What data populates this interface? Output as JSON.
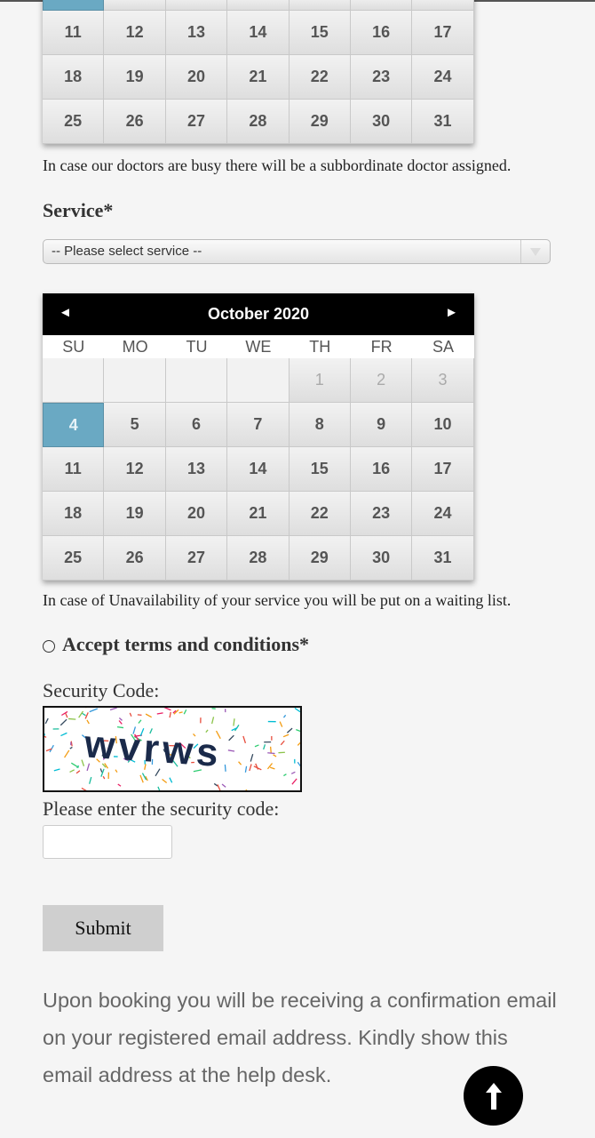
{
  "calendar_top": {
    "rows": [
      [
        "11",
        "12",
        "13",
        "14",
        "15",
        "16",
        "17"
      ],
      [
        "18",
        "19",
        "20",
        "21",
        "22",
        "23",
        "24"
      ],
      [
        "25",
        "26",
        "27",
        "28",
        "29",
        "30",
        "31"
      ]
    ]
  },
  "doctor_note": "In case our doctors are busy there will be a subbordinate doctor assigned.",
  "service": {
    "label": "Service*",
    "placeholder": "-- Please select service --"
  },
  "calendar": {
    "month_title": "October 2020",
    "prev_icon": "◄",
    "next_icon": "►",
    "weekdays": [
      "SU",
      "MO",
      "TU",
      "WE",
      "TH",
      "FR",
      "SA"
    ],
    "selected_day": "4",
    "rows": [
      [
        "",
        "",
        "",
        "",
        "1",
        "2",
        "3"
      ],
      [
        "4",
        "5",
        "6",
        "7",
        "8",
        "9",
        "10"
      ],
      [
        "11",
        "12",
        "13",
        "14",
        "15",
        "16",
        "17"
      ],
      [
        "18",
        "19",
        "20",
        "21",
        "22",
        "23",
        "24"
      ],
      [
        "25",
        "26",
        "27",
        "28",
        "29",
        "30",
        "31"
      ]
    ]
  },
  "waiting_note": "In case of Unavailability of your service you will be put on a waiting list.",
  "terms_label": "Accept terms and conditions*",
  "security": {
    "label": "Security Code:",
    "captcha_text": "wvrws",
    "enter_label": "Please enter the security code:"
  },
  "submit_label": "Submit",
  "info_text": "Upon booking you will be receiving a confirmation email on your registered email address. Kindly show this email address at the help desk.",
  "colors": {
    "selected_day": "#6aa9c3",
    "header_bg": "#000000",
    "submit_bg": "#cfcfcf"
  },
  "icons": {
    "back_to_top": "arrow-up-icon"
  }
}
